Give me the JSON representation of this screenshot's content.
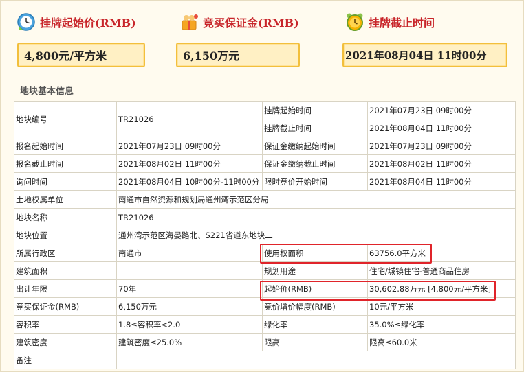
{
  "header": {
    "start_price": {
      "label": "挂牌起始价(RMB)",
      "value": "4,800元/平方米"
    },
    "deposit": {
      "label": "竞买保证金(RMB)",
      "value": "6,150万元"
    },
    "end_time": {
      "label": "挂牌截止时间",
      "value": "2021年08月04日 11时00分"
    }
  },
  "section_title": "地块基本信息",
  "table": {
    "plot_no_k": "地块编号",
    "plot_no_v": "TR21026",
    "list_start_k": "挂牌起始时间",
    "list_start_v": "2021年07月23日 09时00分",
    "list_end_k": "挂牌截止时间",
    "list_end_v": "2021年08月04日 11时00分",
    "reg_start_k": "报名起始时间",
    "reg_start_v": "2021年07月23日 09时00分",
    "dep_start_k": "保证金缴纳起始时间",
    "dep_start_v": "2021年07月23日 09时00分",
    "reg_end_k": "报名截止时间",
    "reg_end_v": "2021年08月02日 11时00分",
    "dep_end_k": "保证金缴纳截止时间",
    "dep_end_v": "2021年08月02日 11时00分",
    "inquiry_k": "询问时间",
    "inquiry_v": "2021年08月04日 10时00分-11时00分",
    "bid_start_k": "限时竞价开始时间",
    "bid_start_v": "2021年08月04日 11时00分",
    "owner_k": "土地权属单位",
    "owner_v": "南通市自然资源和规划局通州湾示范区分局",
    "name_k": "地块名称",
    "name_v": "TR21026",
    "loc_k": "地块位置",
    "loc_v": "通州湾示范区海晏路北、S221省道东地块二",
    "district_k": "所属行政区",
    "district_v": "南通市",
    "area_k": "使用权面积",
    "area_v": "63756.0平方米",
    "build_area_k": "建筑面积",
    "build_area_v": "",
    "use_k": "规划用途",
    "use_v": "住宅/城镇住宅-普通商品住房",
    "term_k": "出让年限",
    "term_v": "70年",
    "start_price_k": "起始价(RMB)",
    "start_price_v": "30,602.88万元 [4,800元/平方米]",
    "deposit_k": "竞买保证金(RMB)",
    "deposit_v": "6,150万元",
    "increment_k": "竞价增价幅度(RMB)",
    "increment_v": "10元/平方米",
    "far_k": "容积率",
    "far_v": "1.8≤容积率<2.0",
    "green_k": "绿化率",
    "green_v": "35.0%≤绿化率",
    "density_k": "建筑密度",
    "density_v": "建筑密度≤25.0%",
    "height_k": "限高",
    "height_v": "限高≤60.0米",
    "note_k": "备注",
    "note_v": ""
  },
  "icons": {
    "clock": "clock-icon",
    "gift": "gift-icon",
    "alarm": "alarm-clock-icon"
  },
  "colors": {
    "label_red": "#c8252a",
    "box_fill": "#fff0c4",
    "box_border": "#f2bf3c",
    "highlight": "#e0242a"
  }
}
